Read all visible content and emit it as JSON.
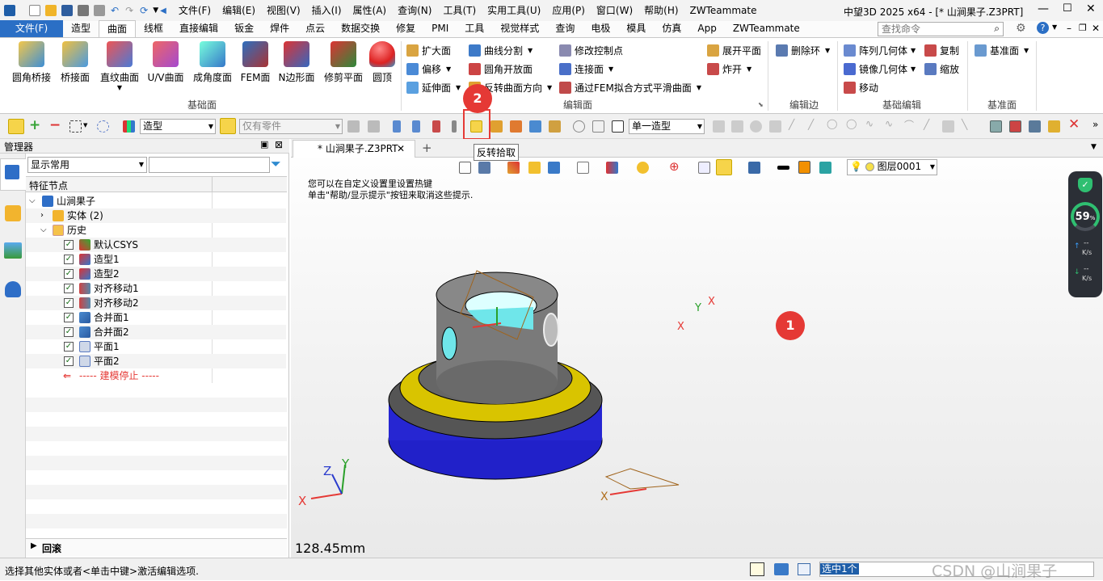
{
  "title": {
    "menus": [
      "文件(F)",
      "编辑(E)",
      "视图(V)",
      "插入(I)",
      "属性(A)",
      "查询(N)",
      "工具(T)",
      "实用工具(U)",
      "应用(P)",
      "窗口(W)",
      "帮助(H)",
      "ZWTeammate"
    ],
    "window_title": "中望3D 2025 x64 - [* 山涧果子.Z3PRT]"
  },
  "tabs": [
    "文件(F)",
    "造型",
    "曲面",
    "线框",
    "直接编辑",
    "钣金",
    "焊件",
    "点云",
    "数据交换",
    "修复",
    "PMI",
    "工具",
    "视觉样式",
    "查询",
    "电极",
    "模具",
    "仿真",
    "App",
    "ZWTeammate"
  ],
  "search": {
    "placeholder": "查找命令"
  },
  "ribbon": {
    "group_basic_surface": {
      "label": "基础面",
      "buttons": [
        "圆角桥接",
        "桥接面",
        "直纹曲面",
        "U/V曲面",
        "成角度面",
        "FEM面",
        "N边形面",
        "修剪平面",
        "圆顶"
      ]
    },
    "group_edit_surface": {
      "label": "编辑面",
      "col1": [
        "扩大面",
        "偏移",
        "延伸面"
      ],
      "col2": [
        "曲线分割",
        "圆角开放面",
        "反转曲面方向"
      ],
      "col3": [
        "修改控制点",
        "连接面",
        "通过FEM拟合方式平滑曲面"
      ],
      "col4": [
        "展开平面",
        "炸开"
      ]
    },
    "group_edit_edge": {
      "label": "编辑边",
      "buttons": [
        "删除环"
      ]
    },
    "group_basic_edit": {
      "label": "基础编辑",
      "buttons": [
        "阵列几何体",
        "镜像几何体",
        "移动",
        "复制",
        "缩放"
      ]
    },
    "group_datum": {
      "label": "基准面",
      "buttons": [
        "基准面"
      ]
    }
  },
  "toolbar": {
    "filter_combo": "造型",
    "parts_combo": "仅有零件",
    "mode_combo": "单一造型",
    "tooltip": "反转拾取"
  },
  "manager": {
    "title": "管理器",
    "display_combo": "显示常用",
    "column_header": "特征节点",
    "tree": {
      "root": "山涧果子",
      "solid": "实体 (2)",
      "history": "历史",
      "items": [
        "默认CSYS",
        "造型1",
        "造型2",
        "对齐移动1",
        "对齐移动2",
        "合并面1",
        "合并面2",
        "平面1",
        "平面2"
      ],
      "stop": "----- 建模停止 -----"
    },
    "rollback": "回滚"
  },
  "document_tab": "* 山涧果子.Z3PRT",
  "viewport": {
    "hint_line1": "您可以在自定义设置里设置热键",
    "hint_line2": "单击\"帮助/显示提示\"按钮来取消这些提示.",
    "layer": "图层0001",
    "scale": "128.45mm",
    "badge1": "1",
    "badge2": "2",
    "axis_x": "X",
    "axis_y": "Y",
    "axis_z": "Z"
  },
  "perf_widget": {
    "percent": "59",
    "unit": "%",
    "up": "--",
    "down": "--",
    "rate_unit": "K/s"
  },
  "status": {
    "message": "选择其他实体或者<单击中键>激活编辑选项.",
    "selection": "选中1个",
    "watermark": "CSDN @山涧果子"
  },
  "colors": {
    "accent": "#2b6fc5",
    "badge": "#e53935",
    "highlight": "#e53935"
  }
}
